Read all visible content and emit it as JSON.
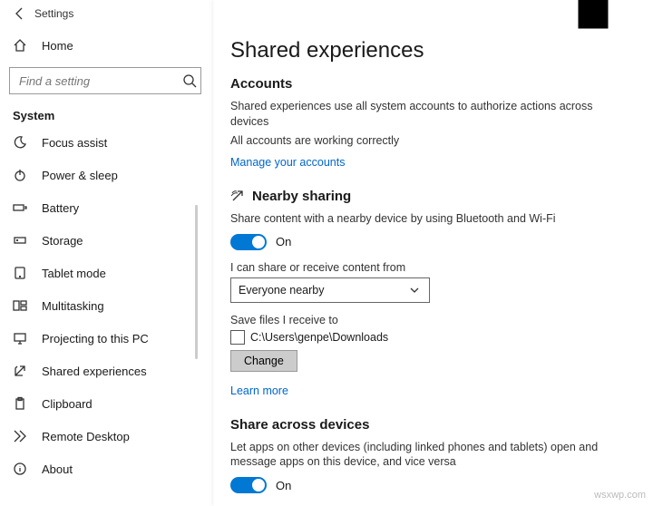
{
  "window": {
    "title": "Settings"
  },
  "home": {
    "label": "Home"
  },
  "search": {
    "placeholder": "Find a setting"
  },
  "section": {
    "label": "System"
  },
  "nav": [
    {
      "id": "focus-assist",
      "label": "Focus assist"
    },
    {
      "id": "power-sleep",
      "label": "Power & sleep"
    },
    {
      "id": "battery",
      "label": "Battery"
    },
    {
      "id": "storage",
      "label": "Storage"
    },
    {
      "id": "tablet-mode",
      "label": "Tablet mode"
    },
    {
      "id": "multitasking",
      "label": "Multitasking"
    },
    {
      "id": "projecting",
      "label": "Projecting to this PC"
    },
    {
      "id": "shared-exp",
      "label": "Shared experiences"
    },
    {
      "id": "clipboard",
      "label": "Clipboard"
    },
    {
      "id": "remote-desktop",
      "label": "Remote Desktop"
    },
    {
      "id": "about",
      "label": "About"
    }
  ],
  "page": {
    "title": "Shared experiences",
    "accounts": {
      "heading": "Accounts",
      "desc": "Shared experiences use all system accounts to authorize actions across devices",
      "status": "All accounts are working correctly",
      "manage_link": "Manage your accounts"
    },
    "nearby": {
      "heading": "Nearby sharing",
      "desc": "Share content with a nearby device by using Bluetooth and Wi-Fi",
      "toggle_state": "On",
      "share_label": "I can share or receive content from",
      "share_select": "Everyone nearby",
      "save_label": "Save files I receive to",
      "save_path": "C:\\Users\\genpe\\Downloads",
      "change_btn": "Change",
      "learn_more": "Learn more"
    },
    "across": {
      "heading": "Share across devices",
      "desc": "Let apps on other devices (including linked phones and tablets) open and message apps on this device, and vice versa",
      "toggle_state": "On"
    }
  },
  "watermark": "wsxwp.com"
}
